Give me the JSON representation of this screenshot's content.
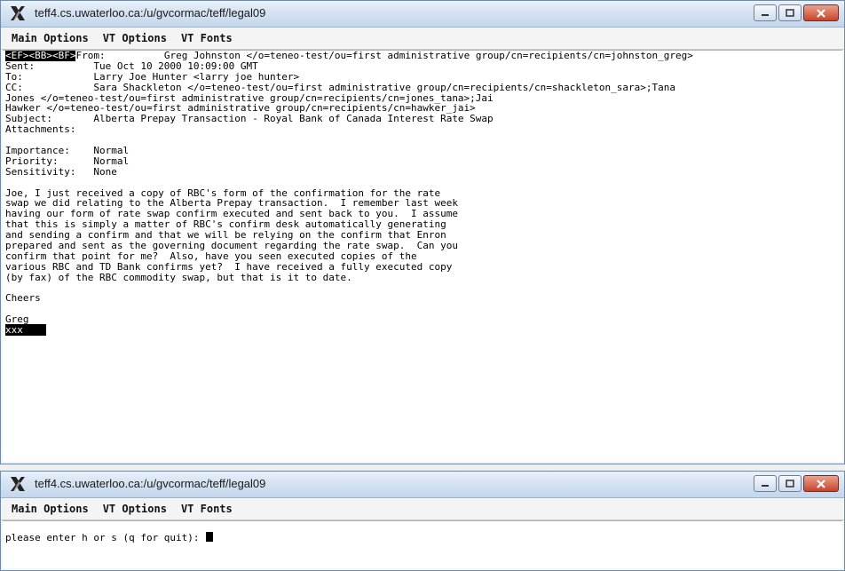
{
  "window_top": {
    "title": "teff4.cs.uwaterloo.ca:/u/gvcormac/teff/legal09",
    "menus": [
      "Main Options",
      "VT Options",
      "VT Fonts"
    ],
    "highlight_prefix": "<EF><BB><BF>",
    "lines": [
      "From:          Greg Johnston </o=teneo-test/ou=first administrative group/cn=recipients/cn=johnston_greg>",
      "Sent:          Tue Oct 10 2000 10:09:00 GMT",
      "To:            Larry Joe Hunter <larry joe hunter>",
      "CC:            Sara Shackleton </o=teneo-test/ou=first administrative group/cn=recipients/cn=shackleton_sara>;Tana",
      "Jones </o=teneo-test/ou=first administrative group/cn=recipients/cn=jones_tana>;Jai",
      "Hawker </o=teneo-test/ou=first administrative group/cn=recipients/cn=hawker_jai>",
      "Subject:       Alberta Prepay Transaction - Royal Bank of Canada Interest Rate Swap",
      "Attachments:",
      "",
      "Importance:    Normal",
      "Priority:      Normal",
      "Sensitivity:   None",
      "",
      "Joe, I just received a copy of RBC's form of the confirmation for the rate",
      "swap we did relating to the Alberta Prepay transaction.  I remember last week",
      "having our form of rate swap confirm executed and sent back to you.  I assume",
      "that this is simply a matter of RBC's confirm desk automatically generating",
      "and sending a confirm and that we will be relying on the confirm that Enron",
      "prepared and sent as the governing document regarding the rate swap.  Can you",
      "confirm that point for me?  Also, have you seen executed copies of the",
      "various RBC and TD Bank confirms yet?  I have received a fully executed copy",
      "(by fax) of the RBC commodity swap, but that is it to date.",
      "",
      "Cheers",
      "",
      "Greg"
    ],
    "status_line": "xxx"
  },
  "window_bottom": {
    "title": "teff4.cs.uwaterloo.ca:/u/gvcormac/teff/legal09",
    "menus": [
      "Main Options",
      "VT Options",
      "VT Fonts"
    ],
    "lines": [
      "",
      "please enter h or s (q for quit): "
    ]
  }
}
